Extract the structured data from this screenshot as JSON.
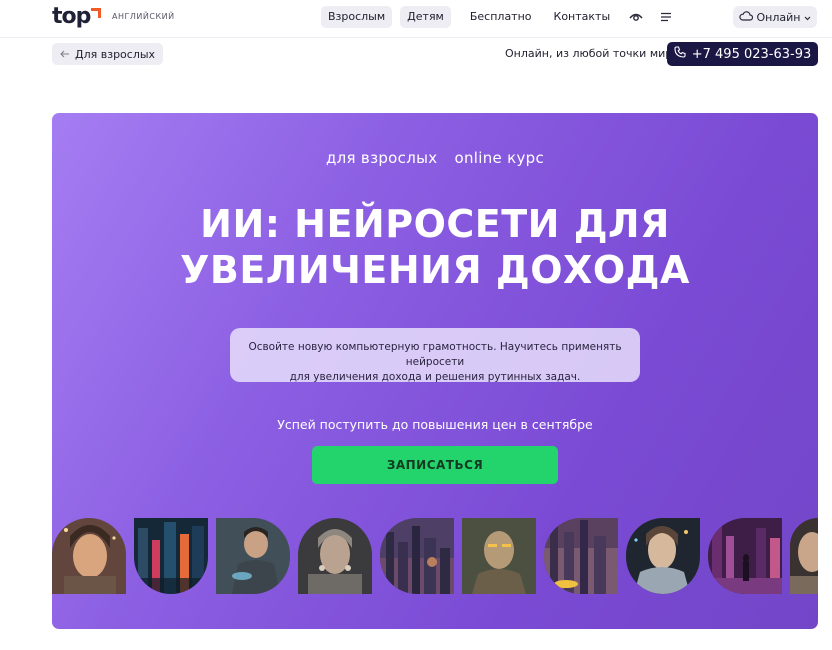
{
  "header": {
    "logo_word": "top",
    "logo_sub": "АНГЛИЙСКИЙ",
    "nav": [
      {
        "label": "Взрослым"
      },
      {
        "label": "Детям"
      },
      {
        "label": "Бесплатно"
      },
      {
        "label": "Контакты"
      }
    ],
    "online_label": "Онлайн"
  },
  "subbar": {
    "back_label": "Для взрослых",
    "online_note": "Онлайн, из любой точки мира",
    "phone": "+7 495 023-63-93"
  },
  "hero": {
    "tag_audience": "для взрослых",
    "tag_format": "online курс",
    "title_line1": "ИИ: НЕЙРОСЕТИ ДЛЯ",
    "title_line2": "УВЕЛИЧЕНИЯ ДОХОДА",
    "desc_line1": "Освойте новую компьютерную грамотность. Научитесь применять нейросети",
    "desc_line2": "для увеличения дохода и решения рутинных задач.",
    "deadline": "Успей поступить до повышения цен в сентябре",
    "cta_label": "ЗАПИСАТЬСЯ"
  },
  "colors": {
    "brand_orange": "#f15a29",
    "hero_purple": "#7a4ad4",
    "cta_green": "#22d46b",
    "phone_bg": "#1a1745"
  },
  "icons": {
    "visually_impaired": "eye-icon",
    "menu": "hamburger-icon",
    "online": "cloud-icon",
    "back": "arrow-left-icon",
    "phone": "phone-icon"
  },
  "gallery": [
    {
      "subject": "ai-woman-portrait"
    },
    {
      "subject": "neon-city-street"
    },
    {
      "subject": "man-with-hologram"
    },
    {
      "subject": "cyborg-woman"
    },
    {
      "subject": "futuristic-city-sunset"
    },
    {
      "subject": "android-face"
    },
    {
      "subject": "city-with-car"
    },
    {
      "subject": "robot-woman-profile"
    },
    {
      "subject": "person-in-neon-city"
    },
    {
      "subject": "cyborg-partial"
    }
  ]
}
